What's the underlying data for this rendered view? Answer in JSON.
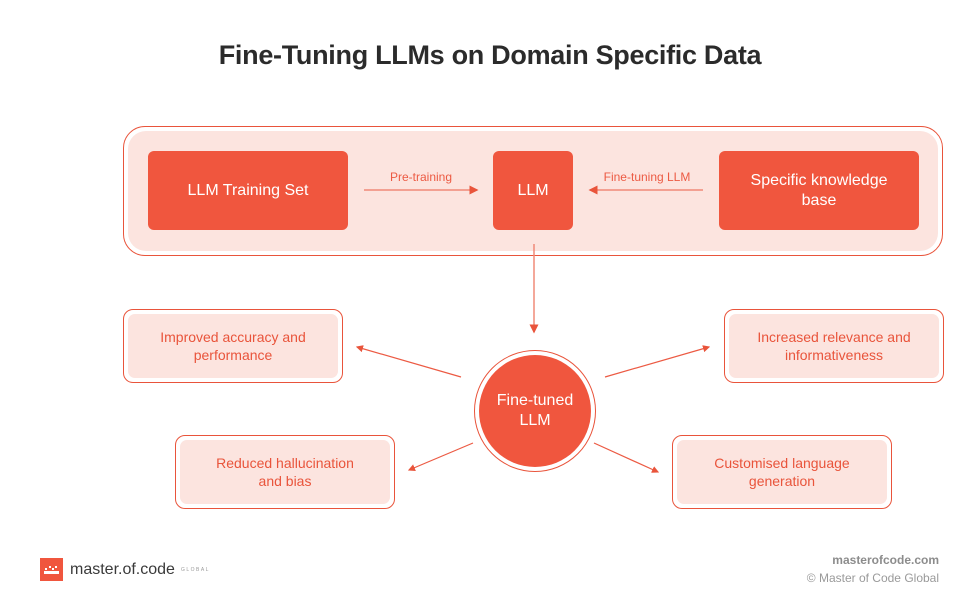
{
  "title": "Fine-Tuning LLMs on Domain Specific Data",
  "top_row": {
    "training_set": "LLM Training Set",
    "llm": "LLM",
    "knowledge_base": "Specific knowledge base",
    "pretraining_label": "Pre-training",
    "finetuning_label": "Fine-tuning LLM"
  },
  "hub": {
    "label": "Fine-tuned LLM"
  },
  "outcomes": [
    "Improved accuracy and performance",
    "Increased relevance and informativeness",
    "Reduced hallucination and bias",
    "Customised language generation"
  ],
  "colors": {
    "accent": "#f0563e",
    "panel_fill": "#fce4df",
    "title": "#2b2b2b"
  },
  "footer": {
    "logo_text": "master.of.code",
    "logo_sub": "GLOBAL",
    "site": "masterofcode.com",
    "copyright": "© Master of Code Global"
  }
}
